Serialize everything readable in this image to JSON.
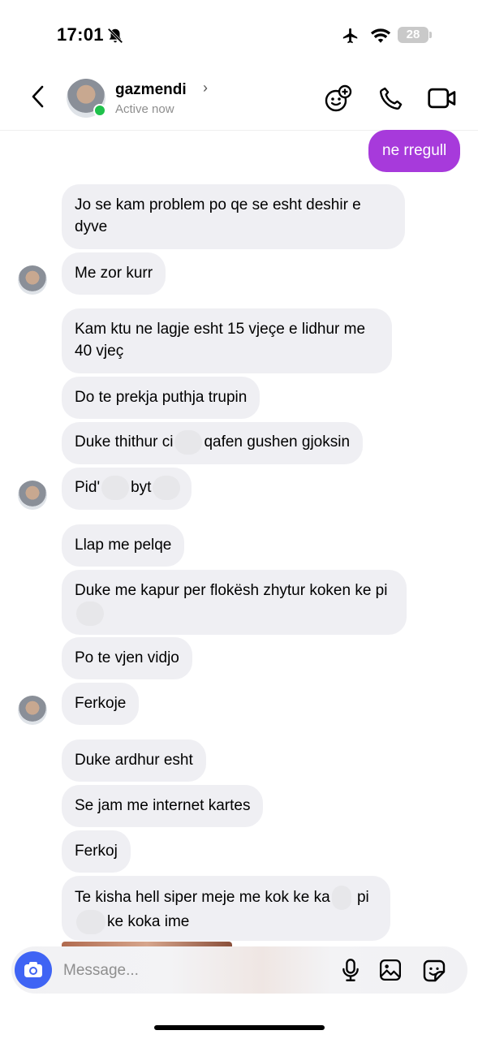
{
  "status_bar": {
    "time": "17:01",
    "battery": "28"
  },
  "header": {
    "name": "gazmendi",
    "status": "Active now",
    "chevron": "›"
  },
  "icons": {
    "back": "chevron-left-icon",
    "avatar_effects": "avatar-effects-icon",
    "call": "phone-icon",
    "video": "video-camera-icon",
    "camera": "camera-icon",
    "mic": "microphone-icon",
    "gallery": "image-icon",
    "sticker": "sticker-icon"
  },
  "colors": {
    "sent_bubble": "#a73adb",
    "received_bubble": "#efeff3",
    "camera_button": "#3f64f4",
    "online": "#1fc14b"
  },
  "messages": [
    {
      "dir": "sent",
      "text": "ne rregull"
    },
    {
      "dir": "received",
      "text": "Jo se kam problem po qe se esht deshir e dyve"
    },
    {
      "dir": "received",
      "text": "Me zor kurr"
    },
    {
      "dir": "received",
      "text": "Kam ktu ne lagje esht 15 vjeçe e lidhur me 40 vjeç"
    },
    {
      "dir": "received",
      "text": "Do te prekja puthja trupin"
    },
    {
      "dir": "received",
      "parts": [
        "Duke thithur ci",
        "qafen gushen gjoksin"
      ]
    },
    {
      "dir": "received",
      "parts": [
        "Pid'",
        "byt",
        ""
      ]
    },
    {
      "dir": "received",
      "text": "Llap me pelqe"
    },
    {
      "dir": "received",
      "parts": [
        "Duke me kapur per flokësh zhytur koken ke pi",
        ""
      ]
    },
    {
      "dir": "received",
      "text": "Po te vjen vidjo"
    },
    {
      "dir": "received",
      "text": "Ferkoje"
    },
    {
      "dir": "received",
      "text": "Duke ardhur esht"
    },
    {
      "dir": "received",
      "text": "Se jam me internet kartes"
    },
    {
      "dir": "received",
      "text": "Ferkoj"
    },
    {
      "dir": "received",
      "parts": [
        "Te kisha hell siper meje me kok ke ka",
        "pi",
        "ke koka ime"
      ]
    }
  ],
  "composer": {
    "placeholder": "Message..."
  }
}
